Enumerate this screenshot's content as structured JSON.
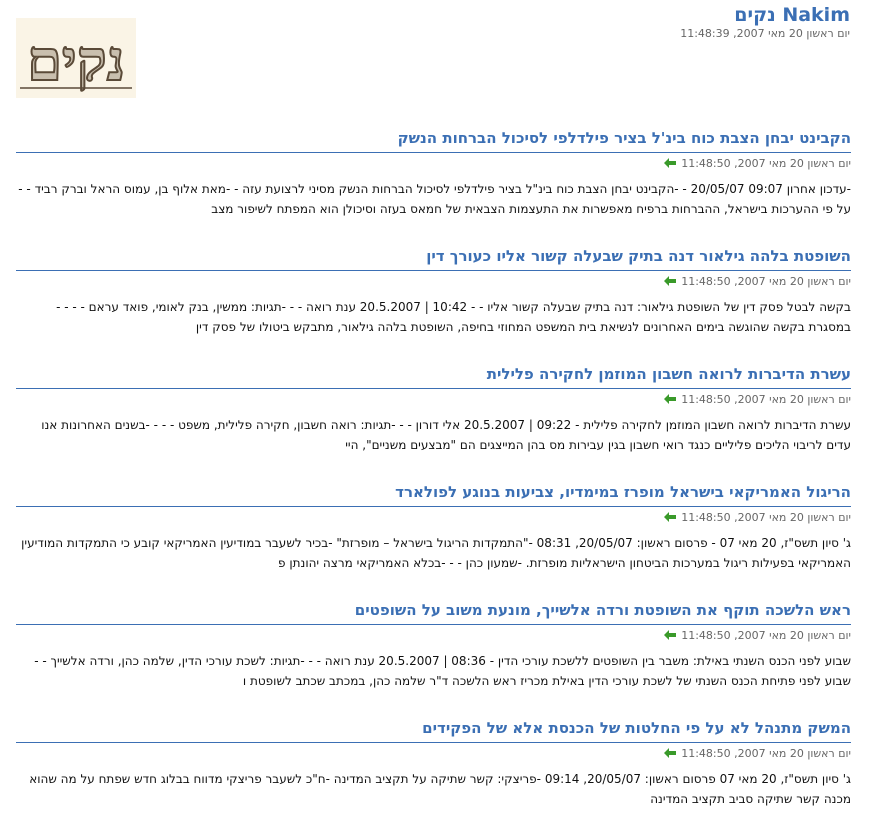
{
  "site": {
    "title": "Nakim נקים",
    "date": "יום ראשון 20 מאי 2007, 11:48:39",
    "logo_text": "נקים"
  },
  "colors": {
    "link": "#3b6fb4",
    "arrow": "#3a9a2a",
    "logo_bg": "#faf4e6",
    "logo_ink": "#5a4a38",
    "logo_fill": "#c9bfae"
  },
  "icons": {
    "item_arrow": "arrow-left-icon"
  },
  "items": [
    {
      "title": "הקבינט יבחן הצבת כוח בינ'ל בציר פילדלפי לסיכול הברחות הנשק",
      "date": "יום ראשון 20 מאי 2007, 11:48:50",
      "description": "-עדכון אחרון 09:07 20/05/07 - -הקבינט יבחן הצבת כוח בינ\"ל בציר פילדלפי לסיכול הברחות הנשק מסיני לרצועת עזה - -מאת אלוף בן, עמוס הראל וברק רביד - -על פי ההערכות בישראל, ההברחות ברפיח מאפשרות את התעצמות הצבאית של חמאס בעזה וסיכולן הוא המפתח לשיפור מצב"
    },
    {
      "title": "השופטת בלהה גילאור דנה בתיק שבעלה קשור אליו כעורך דין",
      "date": "יום ראשון 20 מאי 2007, 11:48:50",
      "description": "בקשה לבטל פסק דין של השופטת גילאור: דנה בתיק שבעלה קשור אליו - - 10:42 | 20.5.2007 ענת רואה - - -תגיות: ממשין, בנק לאומי, פואד עראם - - - - במסגרת בקשה שהוגשה בימים האחרונים לנשיאת בית המשפט המחוזי בחיפה, השופטת בלהה גילאור, מתבקש ביטולו של פסק דין"
    },
    {
      "title": "עשרת הדיברות לרואה חשבון המוזמן לחקירה פלילית",
      "date": "יום ראשון 20 מאי 2007, 11:48:50",
      "description": "עשרת הדיברות לרואה חשבון המוזמן לחקירה פלילית - 09:22 | 20.5.2007 אלי דורון - - -תגיות: רואה חשבון, חקירה פלילית, משפט - - - -בשנים האחרונות אנו עדים לריבוי הליכים פליליים כנגד רואי חשבון בגין עבירות מס בהן המייצגים הם \"מבצעים משניים\", היי"
    },
    {
      "title": "הריגול האמריקאי בישראל מופרז במימדיו, צביעות בנוגע לפולארד",
      "date": "יום ראשון 20 מאי 2007, 11:48:50",
      "description": "ג' סיון תשס\"ז, 20 מאי 07 - פרסום ראשון: 20/05/07, 08:31 -\"התמקדות הריגול בישראל – מופרזת\" -בכיר לשעבר במודיעין האמריקאי קובע כי התמקדות המודיעין האמריקאי בפעילות ריגול במערכות הביטחון הישראליות מופרזת. -שמעון כהן - - -בכלא האמריקאי מרצה יהונתן פ"
    },
    {
      "title": "ראש הלשכה תוקף את השופטת ורדה אלשייך, מונעת משוב על השופטים",
      "date": "יום ראשון 20 מאי 2007, 11:48:50",
      "description": "שבוע לפני הכנס השנתי באילת: משבר בין השופטים ללשכת עורכי הדין - 08:36 | 20.5.2007 ענת רואה - - -תגיות: לשכת עורכי הדין, שלמה כהן, ורדה אלשייך - -שבוע לפני פתיחת הכנס השנתי של לשכת עורכי הדין באילת מכריז ראש הלשכה ד\"ר שלמה כהן, במכתב שכתב לשופטת ו"
    },
    {
      "title": "המשק מתנהל לא על פי החלטות של הכנסת אלא של הפקידים",
      "date": "יום ראשון 20 מאי 2007, 11:48:50",
      "description": "ג' סיון תשס\"ז, 20 מאי 07 פרסום ראשון: 20/05/07, 09:14 -פריצקי: קשר שתיקה על תקציב המדינה -ח\"כ לשעבר פריצקי מדווח בבלוג חדש שפתח על מה שהוא מכנה קשר שתיקה סביב תקציב המדינה"
    }
  ]
}
